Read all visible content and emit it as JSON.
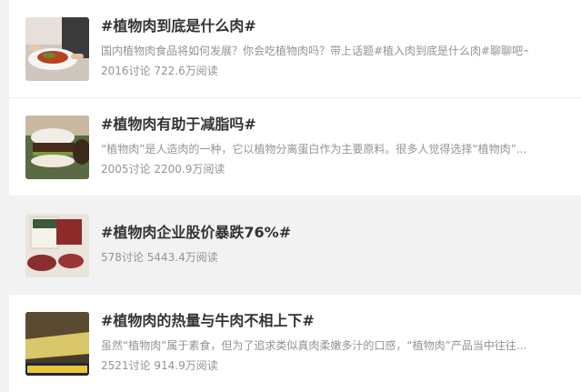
{
  "topics": [
    {
      "title": "#植物肉到底是什么肉#",
      "description": "国内植物肉食品将如何发展？你会吃植物肉吗？带上话题#植入肉到底是什么肉#聊聊吧~",
      "discussions": "2016讨论",
      "reads": "722.6万阅读",
      "thumb_icon": "plant-meat-dish-photo"
    },
    {
      "title": "#植物肉有助于减脂吗#",
      "description": "“植物肉”是人造肉的一种，它以植物分离蛋白作为主要原料。很多人觉得选择“植物肉”...",
      "discussions": "2005讨论",
      "reads": "2200.9万阅读",
      "thumb_icon": "burger-photo"
    },
    {
      "title": "#植物肉企业股价暴跌76%#",
      "description": "",
      "discussions": "578讨论",
      "reads": "5443.4万阅读",
      "thumb_icon": "packaged-patty-photo",
      "thumb_text": "BEYOND MEAT"
    },
    {
      "title": "#植物肉的热量与牛肉不相上下#",
      "description": "虽然“植物肉”属于素食，但为了追求类似真肉柔嫩多汁的口感，“植物肉”产品当中往往...",
      "discussions": "2521讨论",
      "reads": "914.9万阅读",
      "thumb_icon": "video-frame-photo",
      "thumb_text": "的热量与牛肉不相"
    }
  ],
  "colors": {
    "title": "#333333",
    "meta": "#939393",
    "highlight_row": "#f2f2f2"
  }
}
